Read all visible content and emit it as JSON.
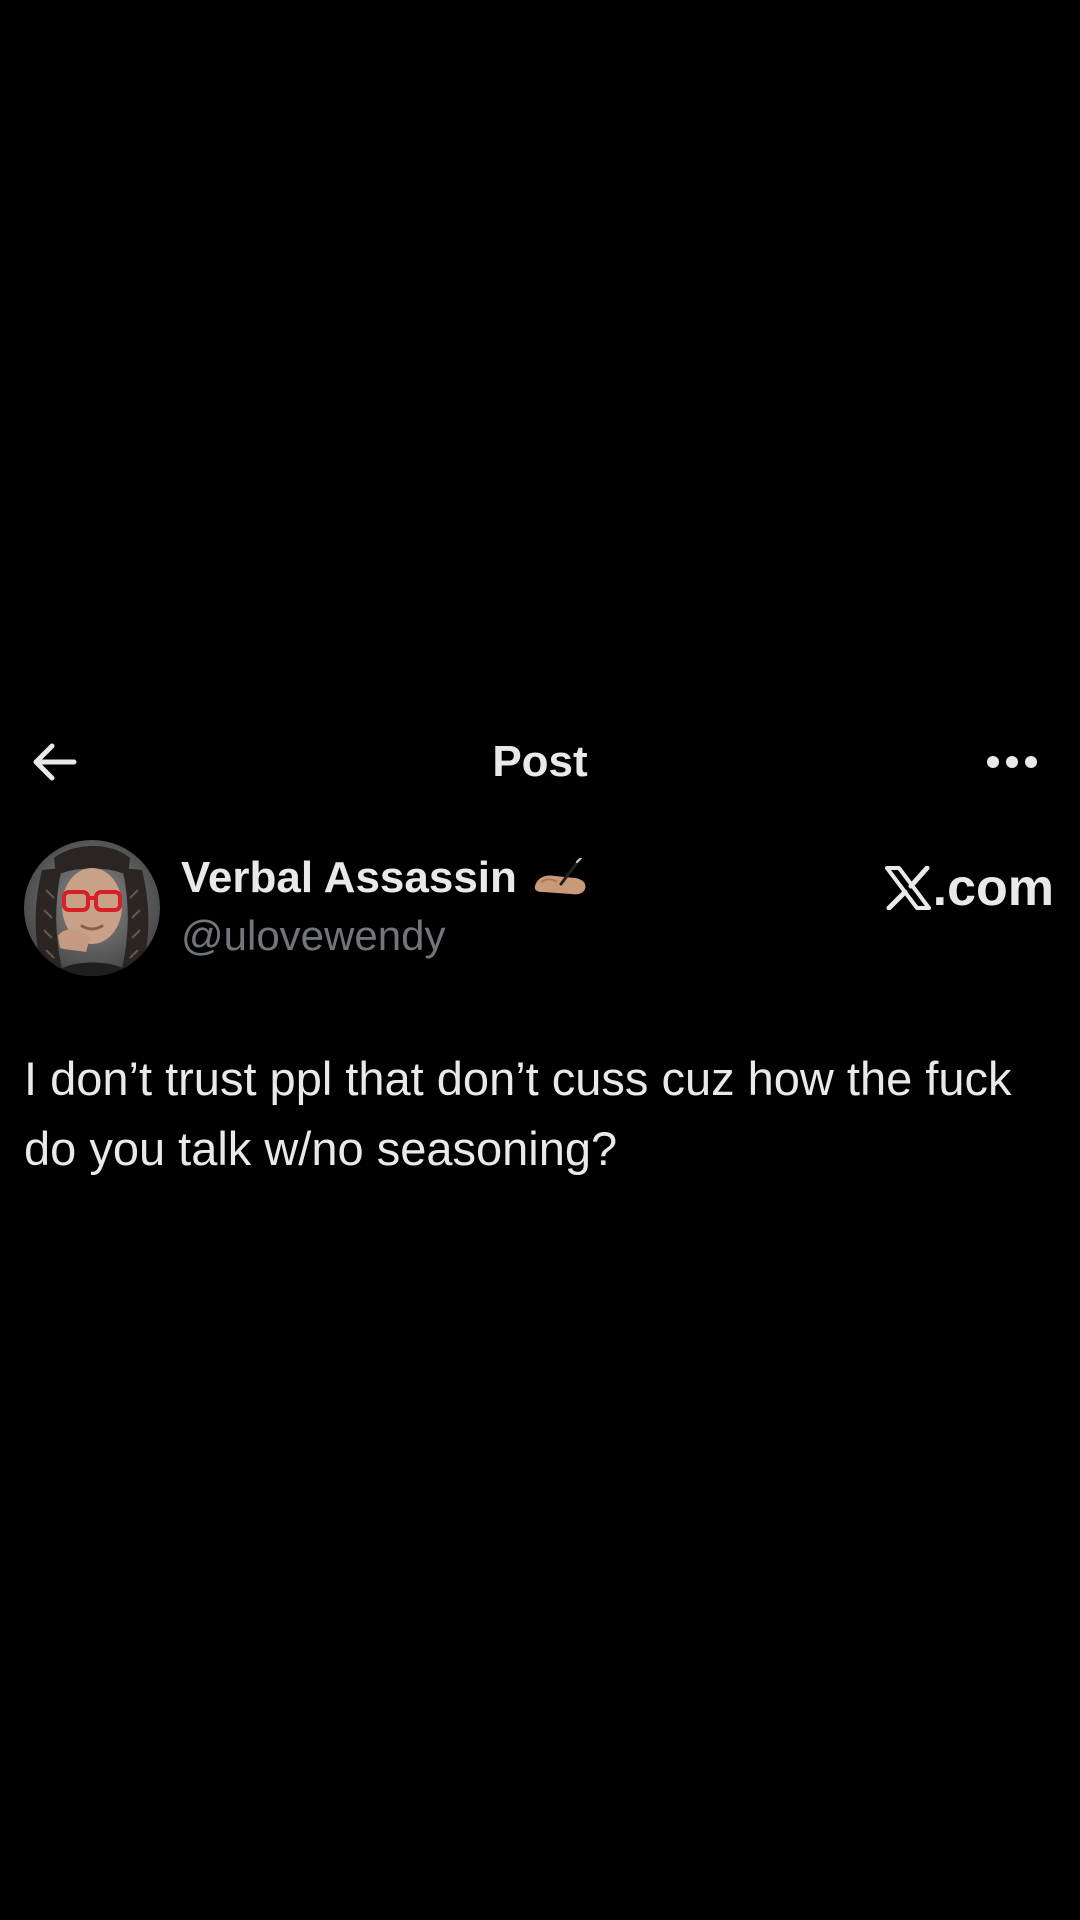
{
  "header": {
    "title": "Post",
    "back_icon": "arrow-left-icon",
    "more_icon": "more-horizontal-icon"
  },
  "author": {
    "name": "Verbal Assassin",
    "name_emoji": "writing-hand-emoji",
    "handle": "@ulovewendy"
  },
  "watermark": {
    "text": ".com",
    "logo": "x-logo-icon"
  },
  "post": {
    "text": "I don’t trust ppl that don’t cuss cuz how the fuck do you talk w/no seasoning?"
  },
  "colors": {
    "background": "#000000",
    "text_primary": "#e7e9ea",
    "text_secondary": "#71767b",
    "glasses_accent": "#d61f26"
  }
}
